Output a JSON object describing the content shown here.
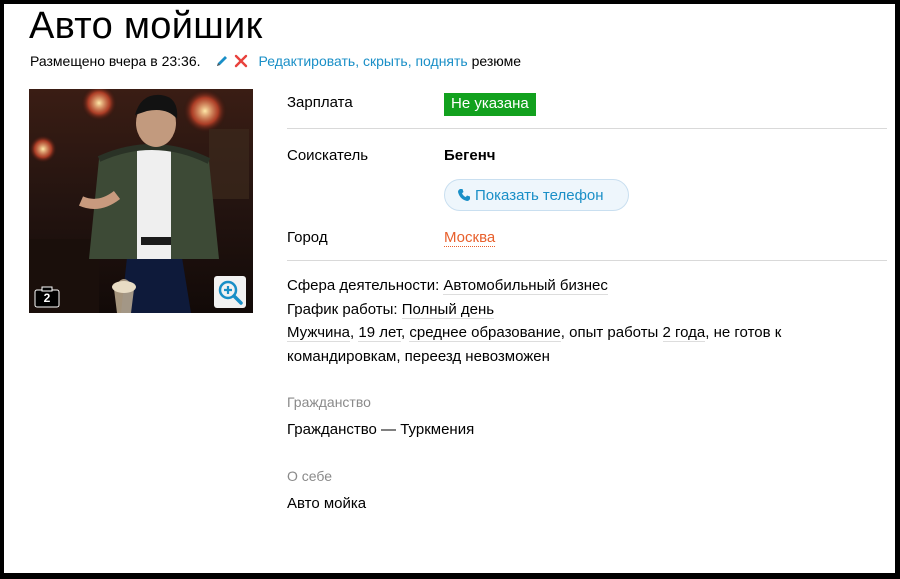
{
  "title": "Авто мойшик",
  "meta": {
    "posted": "Размещено вчера в 23:36.",
    "edit": "Редактировать",
    "hide": "скрыть",
    "raise": "поднять",
    "sep1": ", ",
    "sep2": ", ",
    "suffix": " резюме"
  },
  "photo": {
    "count": "2"
  },
  "salary": {
    "label": "Зарплата",
    "value": "Не указана"
  },
  "applicant": {
    "label": "Соискатель",
    "name": "Бегенч",
    "phone_button": "Показать телефон"
  },
  "city": {
    "label": "Город",
    "value": "Москва"
  },
  "info": {
    "sphere_label": "Сфера деятельности:",
    "sphere_value": "Автомобильный бизнес",
    "schedule_label": "График работы:",
    "schedule_value": "Полный день",
    "gender": "Мужчина",
    "age": "19 лет",
    "education": "среднее образование",
    "experience_label": ", опыт работы ",
    "experience_value": "2 года",
    "travel": ", не готов к",
    "travel2": "командировкам, переезд невозможен"
  },
  "citizenship": {
    "heading": "Гражданство",
    "text": "Гражданство — Туркмения"
  },
  "about": {
    "heading": "О себе",
    "text": "Авто мойка"
  },
  "colors": {
    "salary_badge": "#12a11e",
    "link": "#1a8fc7",
    "city": "#e8602c",
    "heading": "#8a8a8a"
  },
  "icons": [
    "pencil-icon",
    "delete-icon",
    "camera-icon",
    "zoom-in-icon",
    "phone-icon"
  ]
}
